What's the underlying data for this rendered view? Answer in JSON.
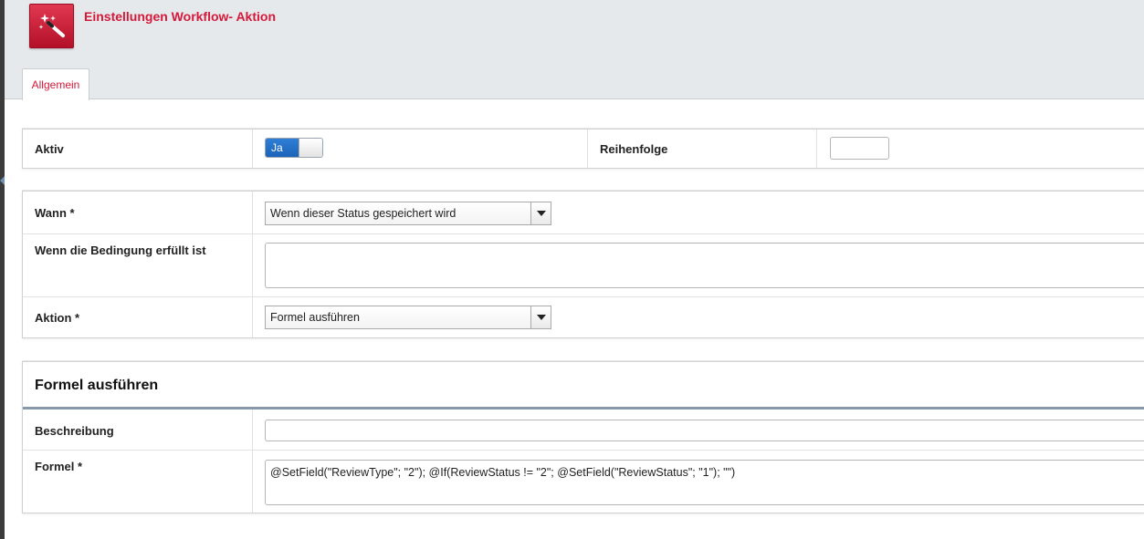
{
  "header": {
    "title": "Einstellungen Workflow- Aktion",
    "app_icon": "magic-wand-icon",
    "accent_color": "#d6193a"
  },
  "tabs": [
    {
      "label": "Allgemein",
      "active": true
    }
  ],
  "general": {
    "aktiv_label": "Aktiv",
    "aktiv_toggle_value": "Ja",
    "reihenfolge_label": "Reihenfolge",
    "reihenfolge_value": ""
  },
  "trigger": {
    "wann_label": "Wann *",
    "wann_value": "Wenn dieser Status gespeichert wird",
    "condition_label": "Wenn die Bedingung erfüllt ist",
    "condition_value": "",
    "aktion_label": "Aktion *",
    "aktion_value": "Formel ausführen"
  },
  "formula_section": {
    "title": "Formel ausführen",
    "beschreibung_label": "Beschreibung",
    "beschreibung_value": "",
    "formel_label": "Formel *",
    "formel_value": "@SetField(\"ReviewType\"; \"2\"); @If(ReviewStatus != \"2\"; @SetField(\"ReviewStatus\"; \"1\"); \"\")"
  }
}
